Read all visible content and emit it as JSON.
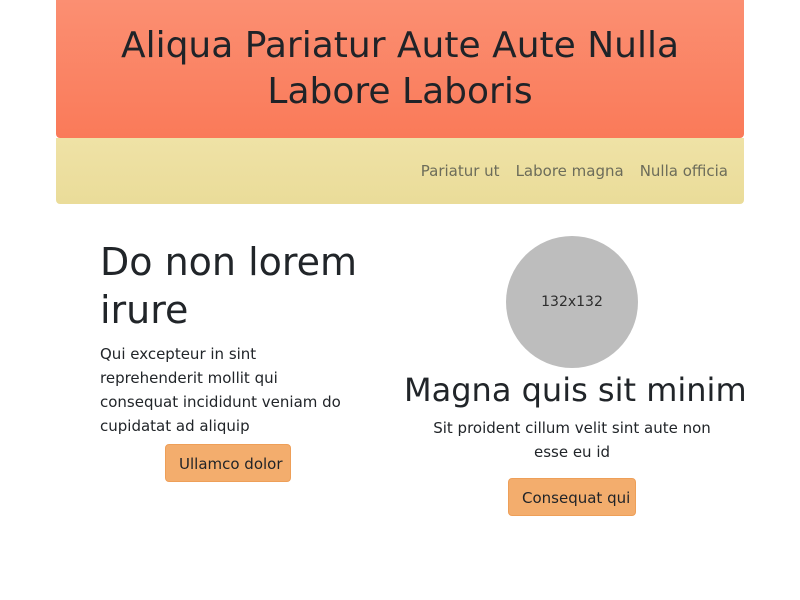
{
  "hero": {
    "title": "Aliqua Pariatur Aute Aute Nulla Labore Laboris"
  },
  "nav": {
    "items": [
      {
        "label": "Pariatur ut"
      },
      {
        "label": "Labore magna"
      },
      {
        "label": "Nulla officia"
      }
    ]
  },
  "left_panel": {
    "heading": "Do non lorem irure",
    "body": "Qui excepteur in sint reprehenderit mollit qui consequat incididunt veniam do cupidatat ad aliquip",
    "button_label": "Ullamco dolor"
  },
  "right_panel": {
    "image_placeholder": "132x132",
    "heading": "Magna quis sit minim",
    "body": "Sit proident cillum velit sint aute non esse eu id",
    "button_label": "Consequat qui"
  },
  "colors": {
    "hero_gradient_top": "#fb8f72",
    "hero_gradient_bottom": "#fa7a59",
    "subnav_bg": "#eadc99",
    "button_bg": "#f3ad6d",
    "image_placeholder_bg": "#bdbdbd"
  }
}
